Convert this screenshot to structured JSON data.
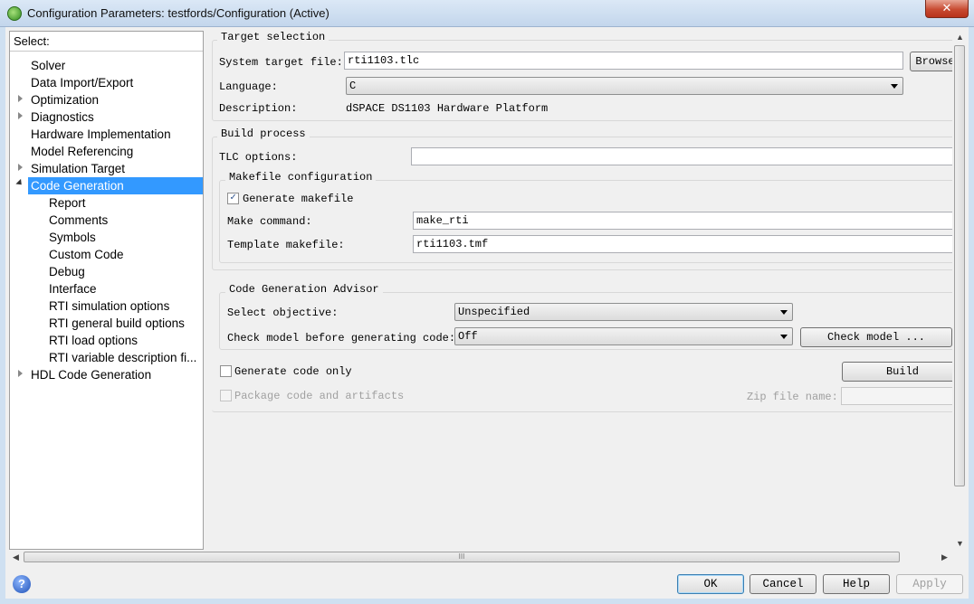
{
  "window": {
    "title": "Configuration Parameters: testfords/Configuration (Active)",
    "close_label": "✕"
  },
  "tree": {
    "header": "Select:",
    "items": [
      {
        "label": "Solver"
      },
      {
        "label": "Data Import/Export"
      },
      {
        "label": "Optimization"
      },
      {
        "label": "Diagnostics"
      },
      {
        "label": "Hardware Implementation"
      },
      {
        "label": "Model Referencing"
      },
      {
        "label": "Simulation Target"
      },
      {
        "label": "Code Generation"
      },
      {
        "label": "Report"
      },
      {
        "label": "Comments"
      },
      {
        "label": "Symbols"
      },
      {
        "label": "Custom Code"
      },
      {
        "label": "Debug"
      },
      {
        "label": "Interface"
      },
      {
        "label": "RTI simulation options"
      },
      {
        "label": "RTI general build options"
      },
      {
        "label": "RTI load options"
      },
      {
        "label": "RTI variable description fi..."
      },
      {
        "label": "HDL Code Generation"
      }
    ]
  },
  "target_selection": {
    "title": "Target selection",
    "system_target_label": "System target file:",
    "system_target_value": "rti1103.tlc",
    "browse_label": "Browse",
    "language_label": "Language:",
    "language_value": "C",
    "description_label": "Description:",
    "description_value": "dSPACE DS1103 Hardware Platform"
  },
  "build_process": {
    "title": "Build process",
    "tlc_options_label": "TLC options:",
    "tlc_options_value": "",
    "makefile": {
      "title": "Makefile configuration",
      "generate_label": "Generate makefile",
      "generate_checked": "✓",
      "make_command_label": "Make command:",
      "make_command_value": "make_rti",
      "template_label": "Template makefile:",
      "template_value": "rti1103.tmf"
    }
  },
  "advisor": {
    "title": "Code Generation Advisor",
    "objective_label": "Select objective:",
    "objective_value": "Unspecified",
    "check_model_label": "Check model before generating code:",
    "check_model_value": "Off",
    "check_model_button": "Check model ..."
  },
  "generate": {
    "code_only_label": "Generate code only",
    "build_label": "Build",
    "package_label": "Package code and artifacts",
    "zip_label": "Zip file name:",
    "zip_value": ""
  },
  "buttons": {
    "help_icon": "?",
    "ok": "OK",
    "cancel": "Cancel",
    "help": "Help",
    "apply": "Apply"
  },
  "scroll": {
    "grip": "III",
    "up": "▲",
    "down": "▼",
    "left": "◀",
    "right": "▶"
  }
}
